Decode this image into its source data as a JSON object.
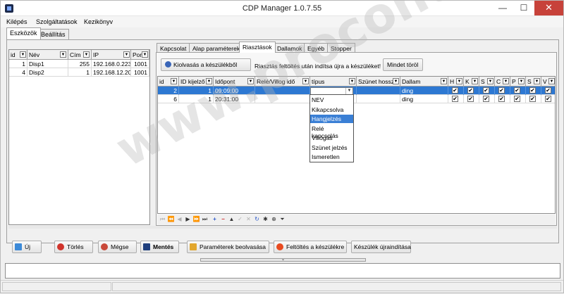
{
  "window": {
    "title": "CDP Manager 1.0.7.55",
    "min": "—",
    "max": "☐",
    "close": "✕"
  },
  "menu": [
    "Kilépés",
    "Szolgáltatások",
    "Kezikönyv"
  ],
  "outer_tabs": [
    "Eszközök",
    "Beállítás"
  ],
  "device_grid": {
    "headers": [
      "id",
      "Név",
      "Cím",
      "IP",
      "Port"
    ],
    "rows": [
      [
        "1",
        "Disp1",
        "255",
        "192.168.0.223",
        "1001"
      ],
      [
        "4",
        "Disp2",
        "1",
        "192.168.12.20",
        "1001"
      ]
    ]
  },
  "inner_tabs": [
    "Kapcsolat",
    "Alap paraméterek",
    "Riasztások",
    "Dallamok",
    "Egyéb",
    "Stopper"
  ],
  "alarm_panel": {
    "read_button": "Kiolvasás a készülékből",
    "info": "Riasztás feltöltés után indítsa újra a készüléket!",
    "clear_button": "Mindet töröl"
  },
  "alarm_grid": {
    "headers": [
      "id",
      "ID kijelző",
      "Időpont",
      "Relé/Villog idő",
      "típus",
      "Szünet hossza",
      "Dallam",
      "H",
      "K",
      "S",
      "C",
      "P",
      "S",
      "V"
    ],
    "rows": [
      [
        "2",
        "1",
        "09:09:00",
        "",
        "",
        "",
        "ding"
      ],
      [
        "6",
        "1",
        "20:31:00",
        "",
        "",
        "",
        "ding"
      ]
    ],
    "check": "✔"
  },
  "type_dropdown": {
    "options": [
      "NEV",
      "Kikapcsolva",
      "Hangjelzés",
      "Relé kapcsolás",
      "Villogás",
      "Szünet jelzés",
      "Ismeretlen"
    ],
    "highlighted": "Hangjelzés"
  },
  "bottom_buttons": [
    "Új",
    "Törlés",
    "Mégse",
    "Mentés",
    "Paraméterek beolvasása",
    "Feltöltés a készülékre",
    "Készülék újraindítása"
  ],
  "watermark": "www.procontrol.hu",
  "colors": {
    "selection": "#2d78d2",
    "close_button": "#c7423a"
  }
}
